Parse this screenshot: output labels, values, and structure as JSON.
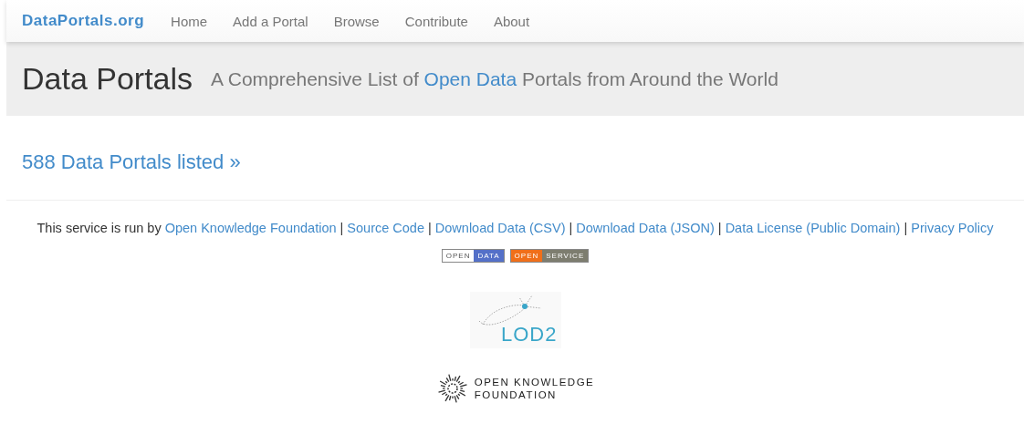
{
  "navbar": {
    "brand": "DataPortals.org",
    "items": [
      "Home",
      "Add a Portal",
      "Browse",
      "Contribute",
      "About"
    ]
  },
  "header": {
    "title": "Data Portals",
    "subtitle_before": "A Comprehensive List of",
    "subtitle_link": "Open Data",
    "subtitle_after": "Portals from Around the World"
  },
  "count_link": "588 Data Portals listed »",
  "footer": {
    "lead": "This service is run by",
    "separator": "|",
    "links": [
      "Open Knowledge Foundation",
      "Source Code",
      "Download Data (CSV)",
      "Download Data (JSON)",
      "Data License (Public Domain)",
      "Privacy Policy"
    ]
  },
  "badges": [
    {
      "kind": "data",
      "left": "OPEN",
      "right": "DATA"
    },
    {
      "kind": "service",
      "left": "OPEN",
      "right": "SERVICE"
    }
  ],
  "lod2_logo": {
    "text": "LOD2"
  },
  "okf_logo": {
    "line1": "OPEN KNOWLEDGE",
    "line2": "FOUNDATION"
  }
}
